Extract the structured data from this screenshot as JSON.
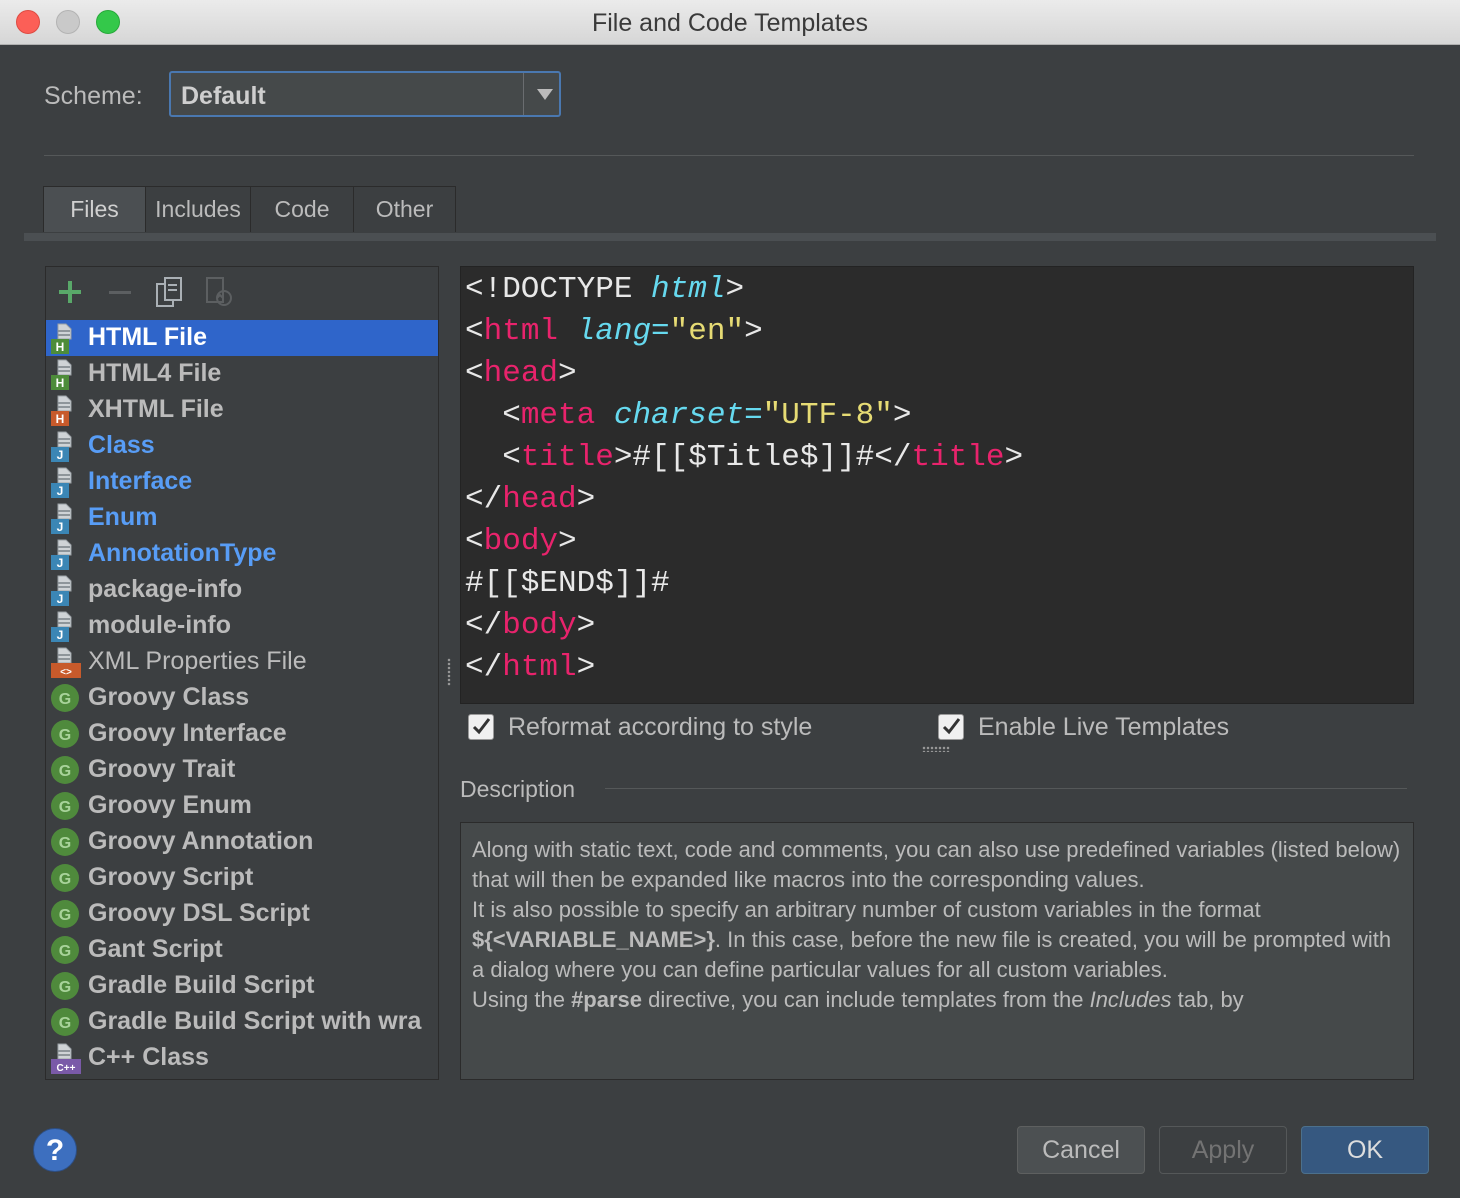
{
  "window": {
    "title": "File and Code Templates"
  },
  "scheme": {
    "label": "Scheme:",
    "value": "Default"
  },
  "tabs": [
    {
      "label": "Files",
      "active": true
    },
    {
      "label": "Includes",
      "active": false
    },
    {
      "label": "Code",
      "active": false
    },
    {
      "label": "Other",
      "active": false
    }
  ],
  "toolbar": {
    "add_icon": "plus-icon",
    "remove_icon": "minus-icon",
    "copy_icon": "copy-icon",
    "reset_icon": "reset-icon"
  },
  "templates": [
    {
      "label": "HTML File",
      "icon": "html-file-icon",
      "badge": "H",
      "badge_color": "#4d8c3a",
      "text_color": "#ffffff",
      "selected": true
    },
    {
      "label": "HTML4 File",
      "icon": "html-file-icon",
      "badge": "H",
      "badge_color": "#4d8c3a",
      "text_color": "#bbbbbb"
    },
    {
      "label": "XHTML File",
      "icon": "xhtml-file-icon",
      "badge": "H",
      "badge_color": "#c75a2b",
      "text_color": "#bbbbbb"
    },
    {
      "label": "Class",
      "icon": "java-file-icon",
      "badge": "J",
      "badge_color": "#3b86b5",
      "text_color": "#589df6"
    },
    {
      "label": "Interface",
      "icon": "java-file-icon",
      "badge": "J",
      "badge_color": "#3b86b5",
      "text_color": "#589df6"
    },
    {
      "label": "Enum",
      "icon": "java-file-icon",
      "badge": "J",
      "badge_color": "#3b86b5",
      "text_color": "#589df6"
    },
    {
      "label": "AnnotationType",
      "icon": "java-file-icon",
      "badge": "J",
      "badge_color": "#3b86b5",
      "text_color": "#589df6"
    },
    {
      "label": "package-info",
      "icon": "java-file-icon",
      "badge": "J",
      "badge_color": "#3b86b5",
      "text_color": "#bbbbbb"
    },
    {
      "label": "module-info",
      "icon": "java-file-icon",
      "badge": "J",
      "badge_color": "#3b86b5",
      "text_color": "#bbbbbb"
    },
    {
      "label": "XML Properties File",
      "icon": "xml-file-icon",
      "badge": "<>",
      "badge_color": "#c75a2b",
      "text_color": "#bbbbbb",
      "regular": true
    },
    {
      "label": "Groovy Class",
      "icon": "groovy-icon",
      "badge": "G",
      "badge_color": "#4f8a3c",
      "text_color": "#bbbbbb"
    },
    {
      "label": "Groovy Interface",
      "icon": "groovy-icon",
      "badge": "G",
      "badge_color": "#4f8a3c",
      "text_color": "#bbbbbb"
    },
    {
      "label": "Groovy Trait",
      "icon": "groovy-icon",
      "badge": "G",
      "badge_color": "#4f8a3c",
      "text_color": "#bbbbbb"
    },
    {
      "label": "Groovy Enum",
      "icon": "groovy-icon",
      "badge": "G",
      "badge_color": "#4f8a3c",
      "text_color": "#bbbbbb"
    },
    {
      "label": "Groovy Annotation",
      "icon": "groovy-icon",
      "badge": "G",
      "badge_color": "#4f8a3c",
      "text_color": "#bbbbbb"
    },
    {
      "label": "Groovy Script",
      "icon": "groovy-icon",
      "badge": "G",
      "badge_color": "#4f8a3c",
      "text_color": "#bbbbbb"
    },
    {
      "label": "Groovy DSL Script",
      "icon": "groovy-icon",
      "badge": "G",
      "badge_color": "#4f8a3c",
      "text_color": "#bbbbbb"
    },
    {
      "label": "Gant Script",
      "icon": "groovy-icon",
      "badge": "G",
      "badge_color": "#4f8a3c",
      "text_color": "#bbbbbb"
    },
    {
      "label": "Gradle Build Script",
      "icon": "groovy-icon",
      "badge": "G",
      "badge_color": "#4f8a3c",
      "text_color": "#bbbbbb"
    },
    {
      "label": "Gradle Build Script with wra",
      "icon": "groovy-icon",
      "badge": "G",
      "badge_color": "#4f8a3c",
      "text_color": "#bbbbbb"
    },
    {
      "label": "C++ Class",
      "icon": "cpp-file-icon",
      "badge": "C++",
      "badge_color": "#7a5aa8",
      "text_color": "#bbbbbb"
    }
  ],
  "editor": {
    "lines": [
      [
        {
          "t": "<!DOCTYPE "
        },
        {
          "t": "html",
          "c": "at"
        },
        {
          "t": ">"
        }
      ],
      [
        {
          "t": "<"
        },
        {
          "t": "html",
          "c": "tg"
        },
        {
          "t": " "
        },
        {
          "t": "lang=",
          "c": "at"
        },
        {
          "t": "\"en\"",
          "c": "st"
        },
        {
          "t": ">"
        }
      ],
      [
        {
          "t": "<"
        },
        {
          "t": "head",
          "c": "tg"
        },
        {
          "t": ">"
        }
      ],
      [
        {
          "t": "  <"
        },
        {
          "t": "meta",
          "c": "tg"
        },
        {
          "t": " "
        },
        {
          "t": "charset=",
          "c": "at"
        },
        {
          "t": "\"UTF-8\"",
          "c": "st"
        },
        {
          "t": ">"
        }
      ],
      [
        {
          "t": "  <"
        },
        {
          "t": "title",
          "c": "tg"
        },
        {
          "t": ">#[[$Title$]]#</"
        },
        {
          "t": "title",
          "c": "tg"
        },
        {
          "t": ">"
        }
      ],
      [
        {
          "t": "</"
        },
        {
          "t": "head",
          "c": "tg"
        },
        {
          "t": ">"
        }
      ],
      [
        {
          "t": "<"
        },
        {
          "t": "body",
          "c": "tg"
        },
        {
          "t": ">"
        }
      ],
      [
        {
          "t": "#[[$END$]]#"
        }
      ],
      [
        {
          "t": "</"
        },
        {
          "t": "body",
          "c": "tg"
        },
        {
          "t": ">"
        }
      ],
      [
        {
          "t": "</"
        },
        {
          "t": "html",
          "c": "tg"
        },
        {
          "t": ">"
        }
      ]
    ]
  },
  "options": {
    "reformat": {
      "label": "Reformat according to style",
      "checked": true
    },
    "live_templates": {
      "label": "Enable Live Templates",
      "checked": true
    }
  },
  "description": {
    "title": "Description",
    "p1": "Along with static text, code and comments, you can also use predefined variables (listed below) that will then be expanded like macros into the corresponding values.",
    "p2_a": "It is also possible to specify an arbitrary number of custom variables in the format ",
    "p2_b": "${<VARIABLE_NAME>}",
    "p2_c": ". In this case, before the new file is created, you will be prompted with a dialog where you can define particular values for all custom variables.",
    "p3_a": "Using the ",
    "p3_b": "#parse",
    "p3_c": " directive, you can include templates from the ",
    "p3_d": "Includes",
    "p3_e": " tab, by"
  },
  "buttons": {
    "help": "?",
    "cancel": "Cancel",
    "apply": "Apply",
    "ok": "OK"
  }
}
